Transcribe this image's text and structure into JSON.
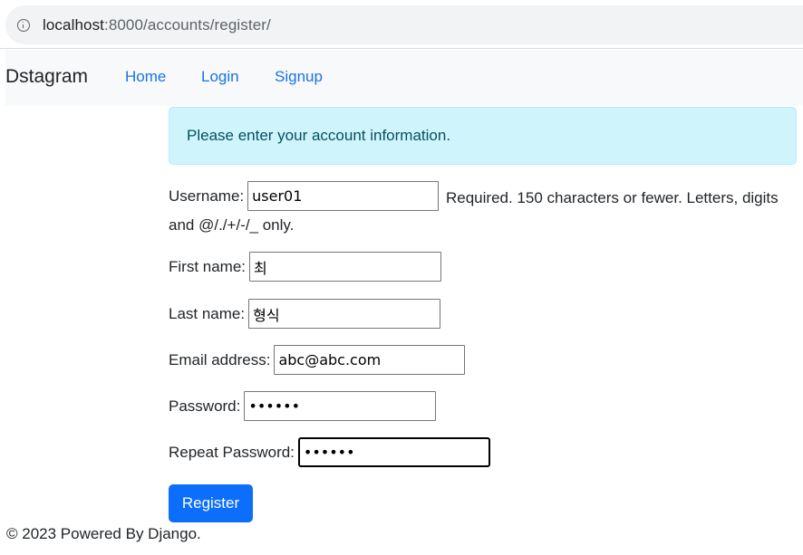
{
  "browser": {
    "url_host": "localhost",
    "url_rest": ":8000/accounts/register/"
  },
  "navbar": {
    "brand": "Dstagram",
    "links": [
      "Home",
      "Login",
      "Signup"
    ]
  },
  "alert": {
    "message": "Please enter your account information."
  },
  "form": {
    "username": {
      "label": "Username:",
      "value": "user01",
      "help": "Required. 150 characters or fewer. Letters, digits and @/./+/-/_ only."
    },
    "first_name": {
      "label": "First name:",
      "value": "최"
    },
    "last_name": {
      "label": "Last name:",
      "value": "형식"
    },
    "email": {
      "label": "Email address:",
      "value": "abc@abc.com"
    },
    "password": {
      "label": "Password:",
      "value": "••••••"
    },
    "repeat_password": {
      "label": "Repeat Password:",
      "value": "••••••"
    },
    "submit_label": "Register"
  },
  "footer": {
    "text": "© 2023 Powered By Django."
  }
}
